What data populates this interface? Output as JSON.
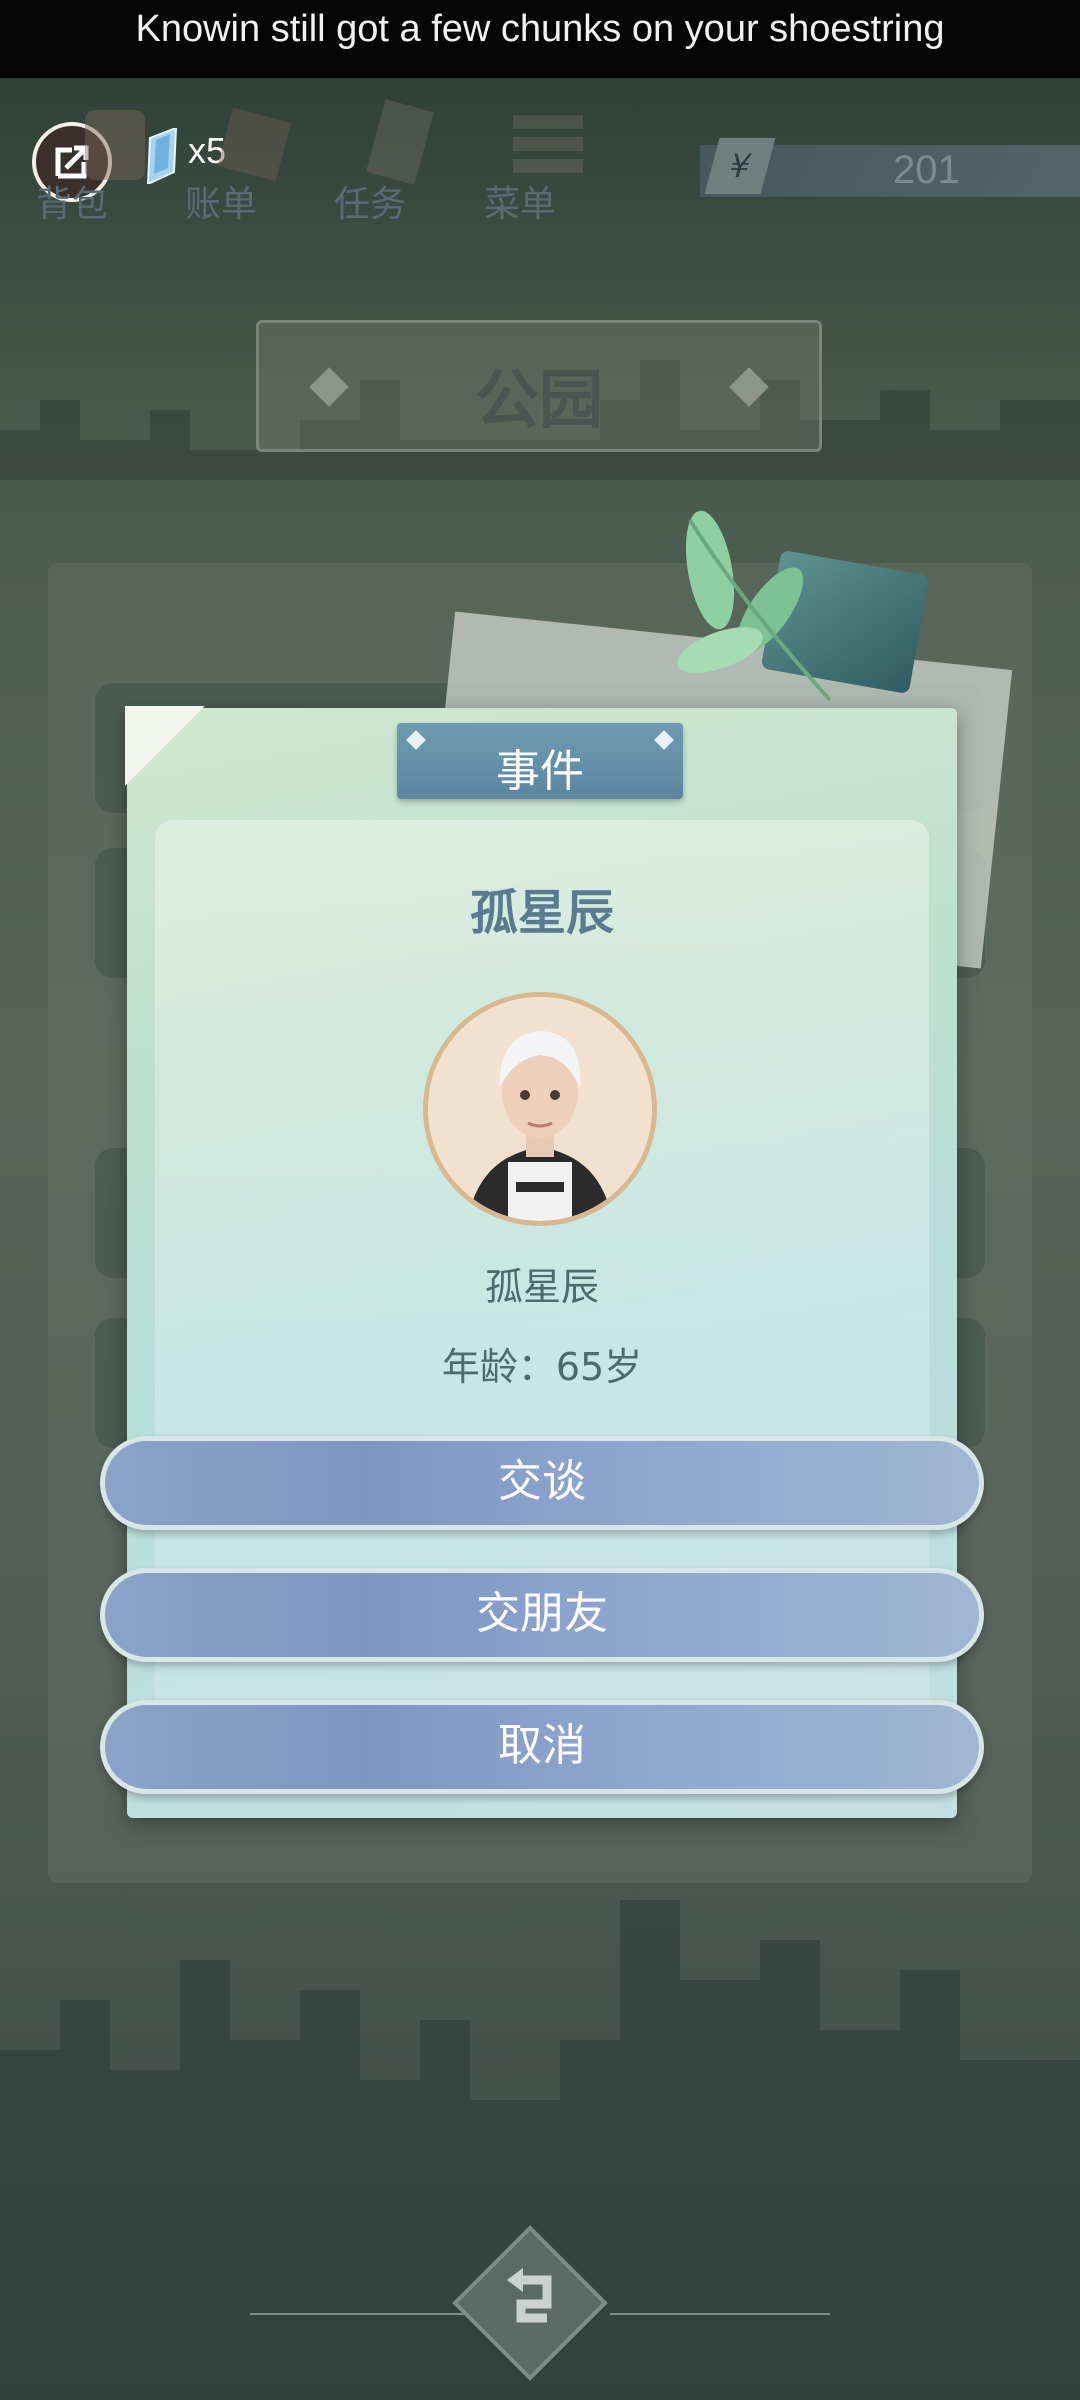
{
  "caption": "Knowin still got a few chunks on your shoestring",
  "topbar": {
    "gem_count": "x5",
    "nav": [
      "背包",
      "账单",
      "任务",
      "菜单"
    ],
    "money_symbol": "¥",
    "money": "201"
  },
  "location": "公园",
  "dialog": {
    "header": "事件",
    "title": "孤星辰",
    "name": "孤星辰",
    "age": "年龄：65岁"
  },
  "actions": [
    "交谈",
    "交朋友",
    "取消"
  ]
}
